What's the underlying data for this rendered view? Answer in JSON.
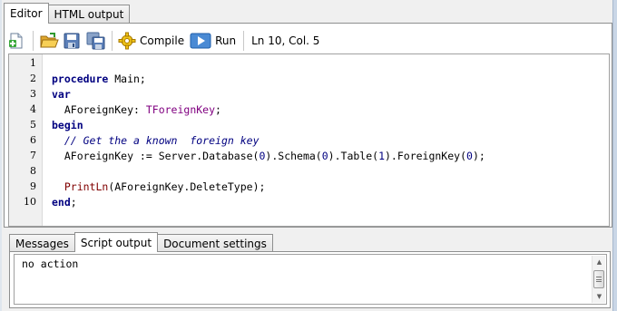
{
  "top_tabs": [
    {
      "label": "Editor",
      "active": true
    },
    {
      "label": "HTML output",
      "active": false
    }
  ],
  "toolbar": {
    "new_icon": "new-file-icon",
    "open_icon": "open-folder-icon",
    "save_icon": "save-disk-icon",
    "save_all_icon": "save-all-icon",
    "compile_label": "Compile",
    "compile_icon": "gear-icon",
    "run_label": "Run",
    "run_icon": "play-icon",
    "status": "Ln 10, Col. 5"
  },
  "editor": {
    "line_numbers": [
      "1",
      "2",
      "3",
      "4",
      "5",
      "6",
      "7",
      "8",
      "9",
      "10"
    ],
    "lines": [
      "",
      "procedure Main;",
      "var",
      "  AForeignKey: TForeignKey;",
      "begin",
      "  // Get the a known  foreign key",
      "  AForeignKey := Server.Database(0).Schema(0).Table(1).ForeignKey(0);",
      "",
      "  PrintLn(AForeignKey.DeleteType);",
      "end;"
    ]
  },
  "bottom_tabs": [
    {
      "label": "Messages",
      "active": false
    },
    {
      "label": "Script output",
      "active": true
    },
    {
      "label": "Document settings",
      "active": false
    }
  ],
  "output": {
    "text": "no action"
  },
  "colors": {
    "keyword": "#000080",
    "type": "#800080",
    "comment": "#000080",
    "function": "#800000",
    "gutter": "#f0f0f0"
  }
}
